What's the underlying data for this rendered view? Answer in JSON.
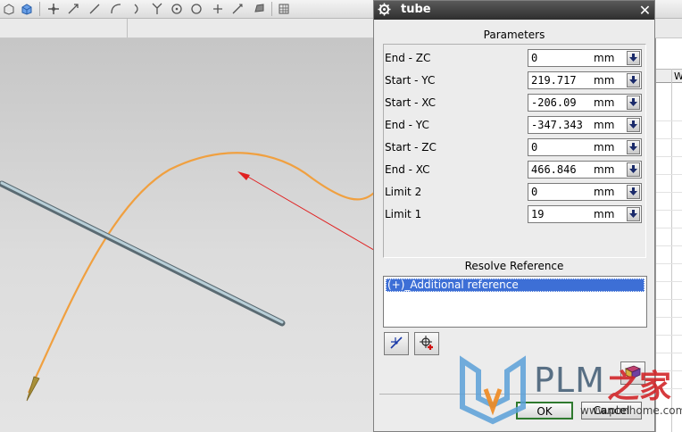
{
  "dialog": {
    "title": "tube",
    "parameters_title": "Parameters",
    "parameters": [
      {
        "label": "End - ZC",
        "value": "0",
        "unit": "mm"
      },
      {
        "label": "Start - YC",
        "value": "219.717",
        "unit": "mm"
      },
      {
        "label": "Start - XC",
        "value": "-206.09",
        "unit": "mm"
      },
      {
        "label": "End - YC",
        "value": "-347.343",
        "unit": "mm"
      },
      {
        "label": "Start - ZC",
        "value": "0",
        "unit": "mm"
      },
      {
        "label": "End - XC",
        "value": "466.846",
        "unit": "mm"
      },
      {
        "label": "Limit 2",
        "value": "0",
        "unit": "mm"
      },
      {
        "label": "Limit 1",
        "value": "19",
        "unit": "mm"
      }
    ],
    "resolve_title": "Resolve Reference",
    "resolve_items": [
      "(+)_Additional reference"
    ],
    "ok_label": "OK",
    "cancel_label": "Cancel"
  },
  "grid": {
    "header": "W"
  },
  "watermark": {
    "brand": "PLM",
    "brand_suffix": "之家",
    "url": "www.plmhome.com"
  },
  "icons": {
    "dialog": "gear-icon",
    "close": "close-icon",
    "dropdown": "arrow-down-icon",
    "tool_1": "line-tool-icon",
    "tool_2": "point-add-icon",
    "book": "book-icon"
  },
  "colors": {
    "curve": "#f0a040",
    "selection": "#3d6fd6",
    "arrow": "#e02020",
    "ok_border": "#2f7a2f",
    "watermark_red": "#d2262a",
    "watermark_blue": "#3f5a72"
  }
}
